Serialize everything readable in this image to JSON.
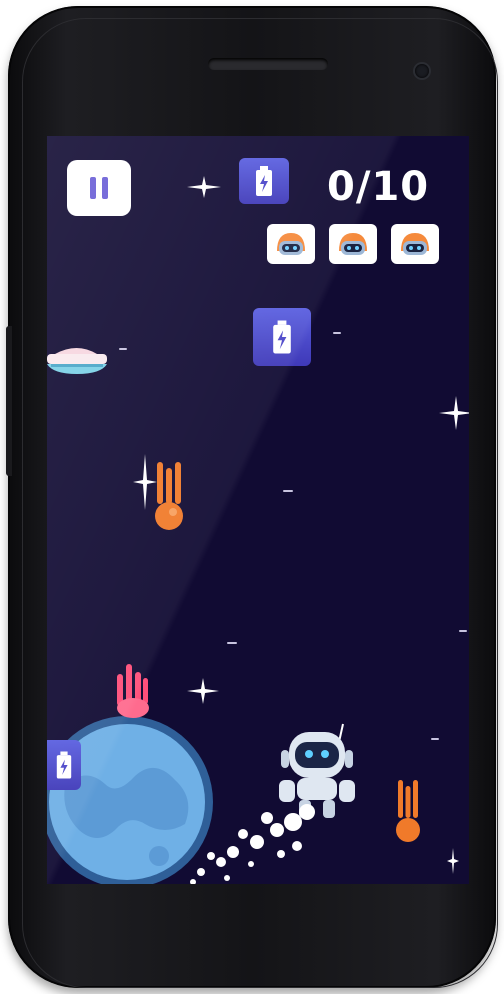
{
  "hud": {
    "score": "0/10",
    "lives_total": 3
  },
  "icons": {
    "pause": "pause-icon",
    "battery": "battery-icon",
    "robot_life": "robot-head-icon",
    "robot": "robot-player-icon",
    "meteor": "meteor-icon",
    "spaceship": "spaceship-icon",
    "planet": "planet-icon",
    "star": "sparkle-star-icon"
  },
  "colors": {
    "background": "#110b33",
    "pause_glyph": "#6b5fd6",
    "battery_tile": "#4b46c9",
    "meteor": "#f07a2a",
    "planet": "#6fb0e6",
    "text": "#ffffff"
  }
}
